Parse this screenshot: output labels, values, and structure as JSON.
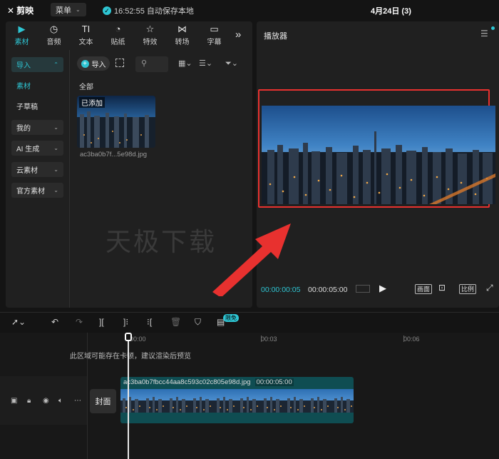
{
  "app": {
    "name": "剪映",
    "menu_label": "菜单",
    "autosave": "16:52:55 自动保存本地",
    "project_title": "4月24日 (3)"
  },
  "tabs": [
    {
      "label": "素材",
      "icon": "media-icon"
    },
    {
      "label": "音频",
      "icon": "audio-icon"
    },
    {
      "label": "文本",
      "icon": "text-icon"
    },
    {
      "label": "贴纸",
      "icon": "sticker-icon"
    },
    {
      "label": "特效",
      "icon": "effects-icon"
    },
    {
      "label": "转场",
      "icon": "transition-icon"
    },
    {
      "label": "字幕",
      "icon": "subtitle-icon"
    }
  ],
  "sidebar": {
    "import": "导入",
    "material": "素材",
    "sub_draft": "子草稿",
    "mine": "我的",
    "ai": "AI 生成",
    "cloud": "云素材",
    "official": "官方素材"
  },
  "media": {
    "import_label": "导入",
    "all_label": "全部",
    "added_tag": "已添加",
    "file_name": "ac3ba0b7f...5e98d.jpg",
    "watermark": "天极下载"
  },
  "player": {
    "title": "播放器",
    "time_current": "00:00:00:05",
    "time_total": "00:00:05:00",
    "btn_canvas": "画面",
    "btn_ratio": "比例"
  },
  "timeline": {
    "limit_badge": "限免",
    "ticks": [
      "00:00",
      "00:03",
      "00:06"
    ],
    "note": "此区域可能存在卡顿，建议渲染后预览",
    "cover_label": "封面",
    "clip_name": "ac3ba0b7fbcc44aa8c593c02c805e98d.jpg",
    "clip_duration": "00:00:05:00"
  },
  "colors": {
    "accent": "#2ec5d3",
    "highlight": "#e8312f"
  }
}
